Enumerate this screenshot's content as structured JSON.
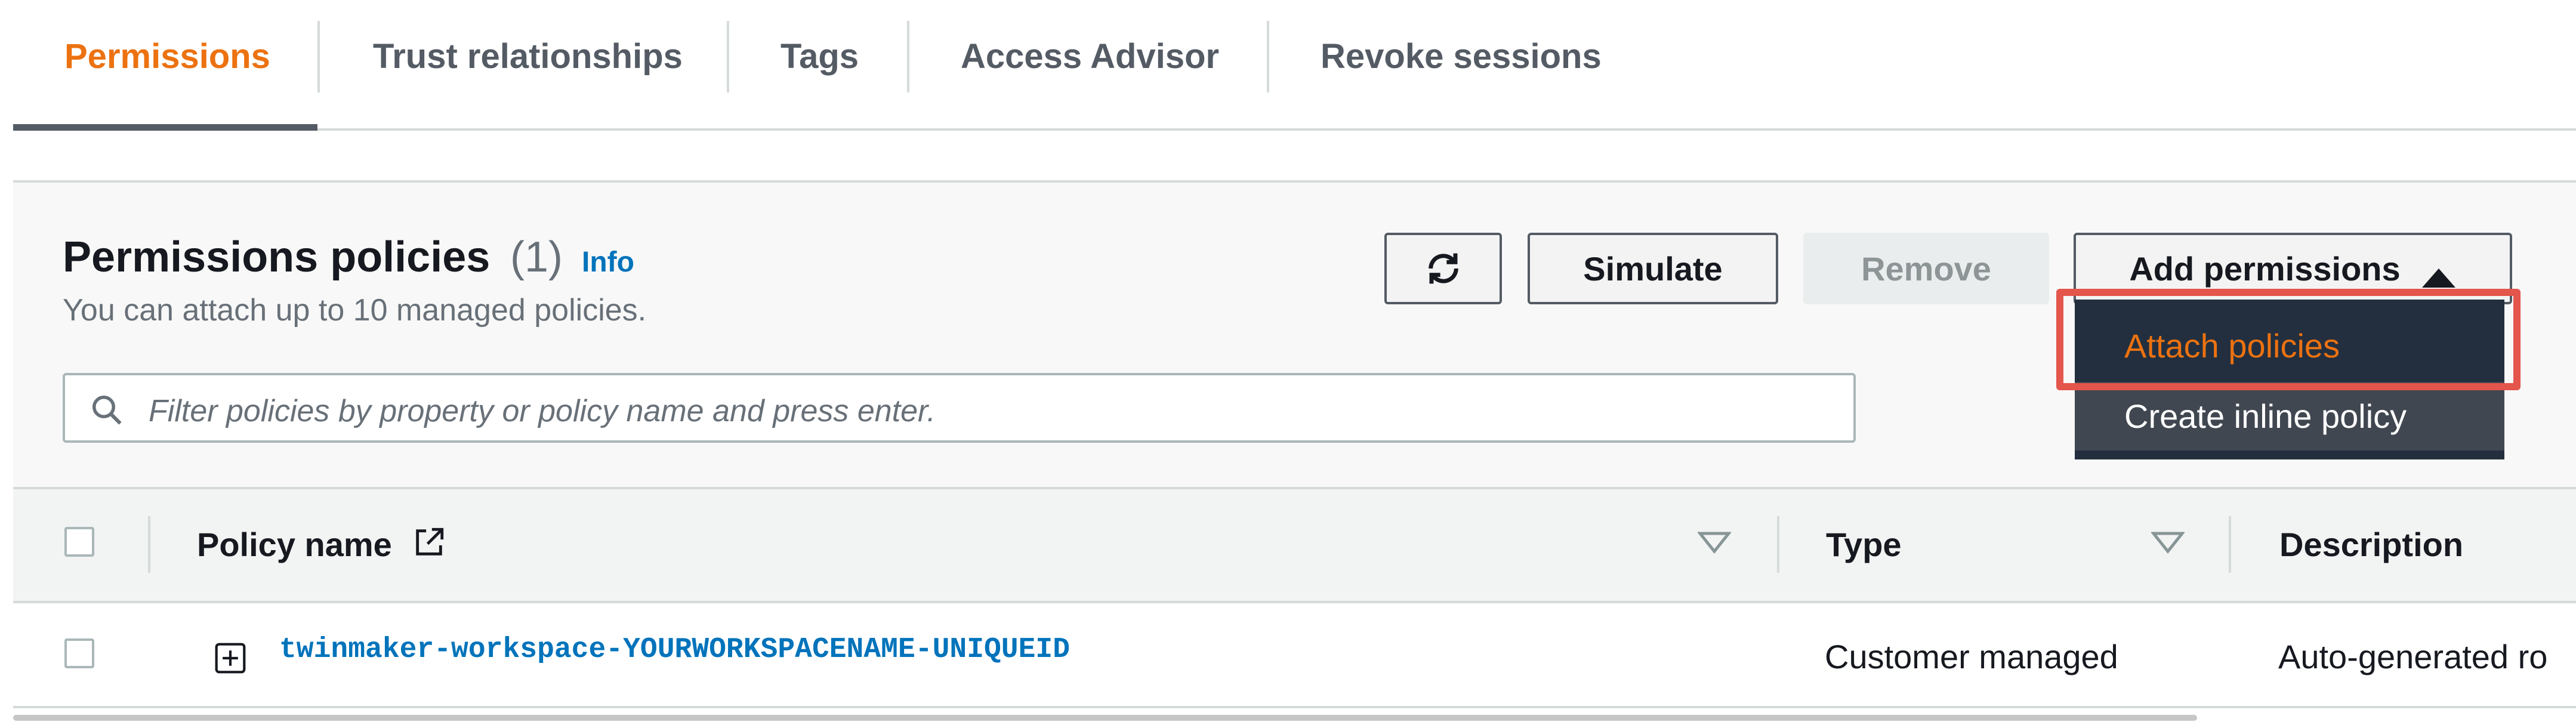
{
  "tabs": [
    {
      "label": "Permissions",
      "active": true
    },
    {
      "label": "Trust relationships",
      "active": false
    },
    {
      "label": "Tags",
      "active": false
    },
    {
      "label": "Access Advisor",
      "active": false
    },
    {
      "label": "Revoke sessions",
      "active": false
    }
  ],
  "policies_panel": {
    "title": "Permissions policies",
    "count": "(1)",
    "info_label": "Info",
    "subtitle": "You can attach up to 10 managed policies.",
    "buttons": {
      "refresh_icon": "refresh-icon",
      "simulate": "Simulate",
      "remove": "Remove",
      "add_permissions": "Add permissions",
      "add_permissions_icon": "caret-up-icon"
    },
    "search": {
      "placeholder": "Filter policies by property or policy name and press enter.",
      "icon": "search-icon"
    },
    "dropdown": [
      {
        "label": "Attach policies",
        "highlighted": true
      },
      {
        "label": "Create inline policy",
        "highlighted": false
      }
    ]
  },
  "table": {
    "columns": [
      "Policy name",
      "Type",
      "Description"
    ],
    "rows": [
      {
        "policy_name": "twinmaker-workspace-YOURWORKSPACENAME-UNIQUEID",
        "type": "Customer managed",
        "description": "Auto-generated ro"
      }
    ]
  },
  "colors": {
    "accent": "#ec7211",
    "link": "#0073bb",
    "highlight_border": "#e4554b",
    "dropdown_bg": "#232f3e"
  }
}
